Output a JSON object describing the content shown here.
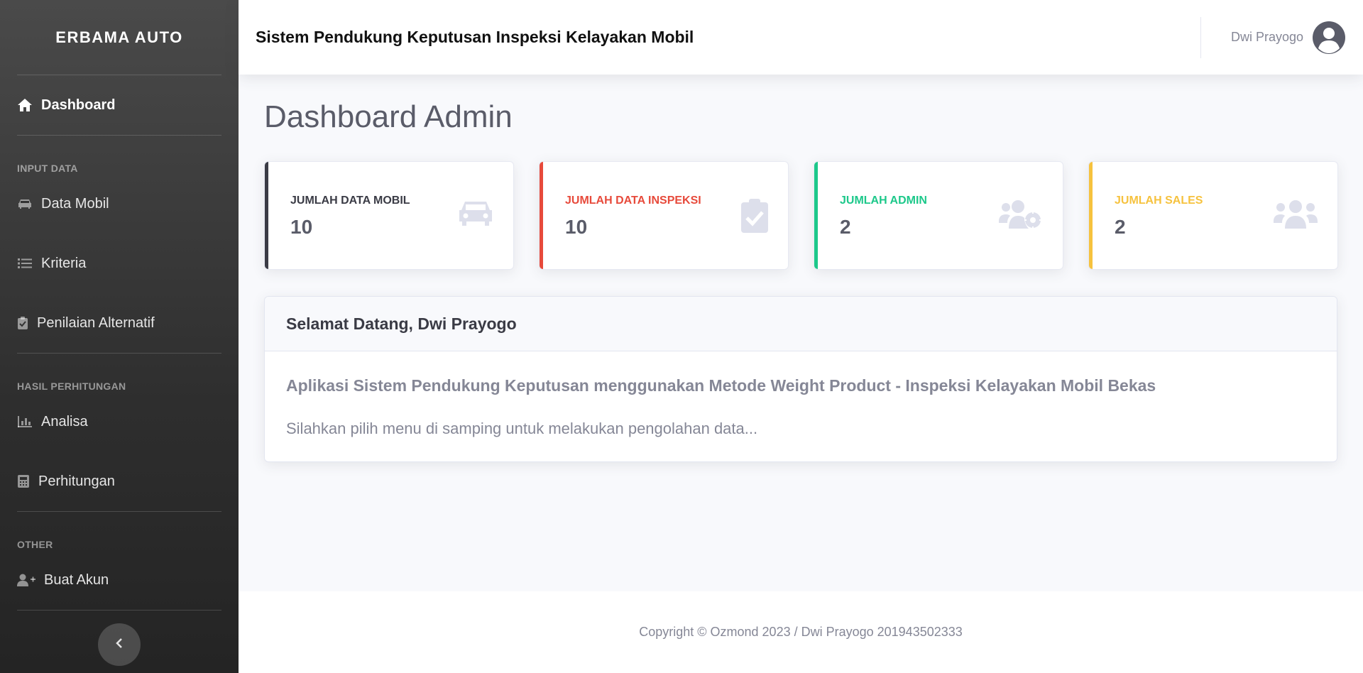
{
  "sidebar": {
    "brand": "ERBAMA AUTO",
    "dashboard": "Dashboard",
    "heading_input": "INPUT DATA",
    "data_mobil": "Data Mobil",
    "kriteria": "Kriteria",
    "penilaian": "Penilaian Alternatif",
    "heading_hasil": "HASIL PERHITUNGAN",
    "analisa": "Analisa",
    "perhitungan": "Perhitungan",
    "heading_other": "OTHER",
    "buat_akun": "Buat Akun"
  },
  "topbar": {
    "title": "Sistem Pendukung Keputusan Inspeksi Kelayakan Mobil",
    "user": "Dwi Prayogo"
  },
  "page": {
    "title": "Dashboard Admin"
  },
  "cards": [
    {
      "label": "JUMLAH DATA MOBIL",
      "value": "10",
      "color": "#3a3b45",
      "icon": "car-icon"
    },
    {
      "label": "JUMLAH DATA INSPEKSI",
      "value": "10",
      "color": "#e74a3b",
      "icon": "clipboard-check-icon"
    },
    {
      "label": "JUMLAH ADMIN",
      "value": "2",
      "color": "#1cc88a",
      "icon": "users-cog-icon"
    },
    {
      "label": "JUMLAH SALES",
      "value": "2",
      "color": "#f6c23e",
      "icon": "users-icon"
    }
  ],
  "welcome": {
    "heading": "Selamat Datang, Dwi Prayogo",
    "subtitle": "Aplikasi Sistem Pendukung Keputusan menggunakan Metode Weight Product - Inspeksi Kelayakan Mobil Bekas",
    "text": "Silahkan pilih menu di samping untuk melakukan pengolahan data..."
  },
  "footer": {
    "copyright": "Copyright © Ozmond 2023 / Dwi Prayogo 201943502333"
  }
}
